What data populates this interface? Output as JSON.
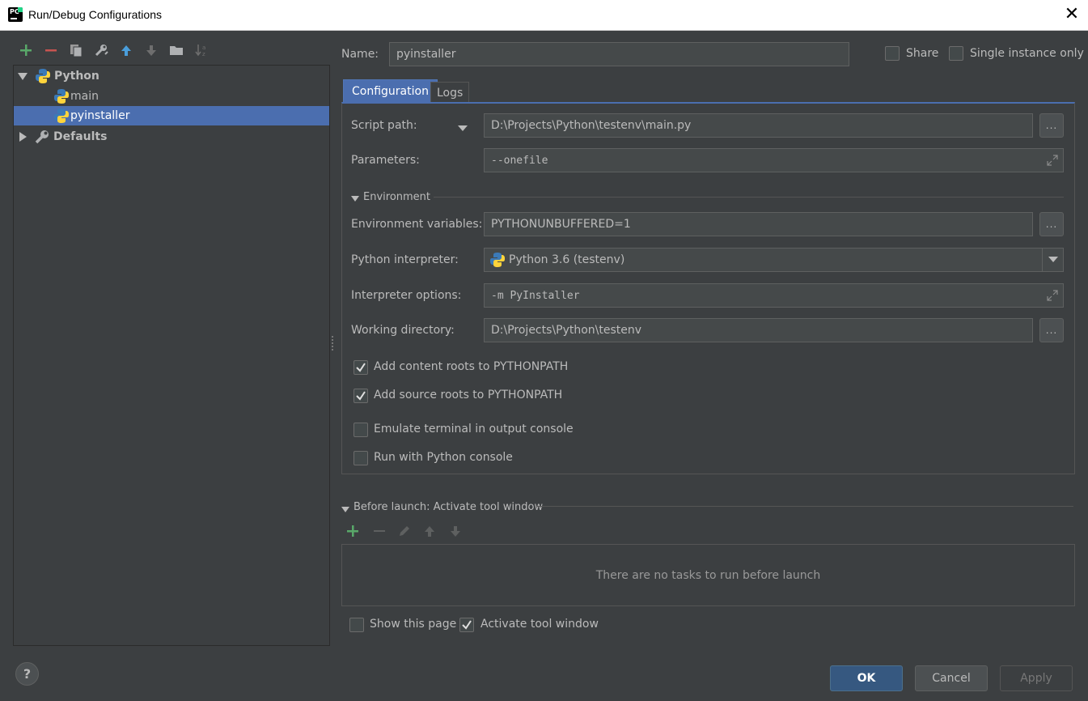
{
  "window": {
    "title": "Run/Debug Configurations",
    "close_glyph": "✕"
  },
  "toolbar": {
    "icons": [
      "add-icon",
      "remove-icon",
      "copy-icon",
      "edit-defaults-icon",
      "move-up-icon",
      "move-down-icon",
      "folder-icon",
      "sort-icon"
    ]
  },
  "tree": {
    "python_label": "Python",
    "main_label": "main",
    "pyinstaller_label": "pyinstaller",
    "defaults_label": "Defaults"
  },
  "header": {
    "name_label": "Name:",
    "name_value": "pyinstaller",
    "share_label": "Share",
    "share_checked": false,
    "single_instance_label": "Single instance only",
    "single_instance_checked": false
  },
  "tabs": {
    "configuration": "Configuration",
    "logs": "Logs"
  },
  "config": {
    "script_path_label": "Script path:",
    "script_path_value": "D:\\Projects\\Python\\testenv\\main.py",
    "parameters_label": "Parameters:",
    "parameters_value": "--onefile",
    "environment_label": "Environment",
    "env_vars_label": "Environment variables:",
    "env_vars_value": "PYTHONUNBUFFERED=1",
    "interpreter_label": "Python interpreter:",
    "interpreter_value": "Python 3.6 (testenv)",
    "interpreter_options_label": "Interpreter options:",
    "interpreter_options_value": "-m PyInstaller",
    "working_dir_label": "Working directory:",
    "working_dir_value": "D:\\Projects\\Python\\testenv",
    "browse_label": "...",
    "add_content_roots_label": "Add content roots to PYTHONPATH",
    "add_content_roots_checked": true,
    "add_source_roots_label": "Add source roots to PYTHONPATH",
    "add_source_roots_checked": true,
    "emulate_terminal_label": "Emulate terminal in output console",
    "emulate_terminal_checked": false,
    "python_console_label": "Run with Python console",
    "python_console_checked": false
  },
  "before_launch": {
    "title": "Before launch: Activate tool window",
    "empty_text": "There are no tasks to run before launch",
    "show_page_label": "Show this page",
    "show_page_checked": false,
    "activate_tool_window_label": "Activate tool window",
    "activate_tool_window_checked": true
  },
  "buttons": {
    "help": "?",
    "ok": "OK",
    "cancel": "Cancel",
    "apply": "Apply"
  },
  "colors": {
    "background": "#3c3f41",
    "selection": "#4b6eaf",
    "field": "#45494a",
    "add_green": "#59a869",
    "remove_red": "#c75450",
    "arrow_blue": "#4a9edb"
  }
}
